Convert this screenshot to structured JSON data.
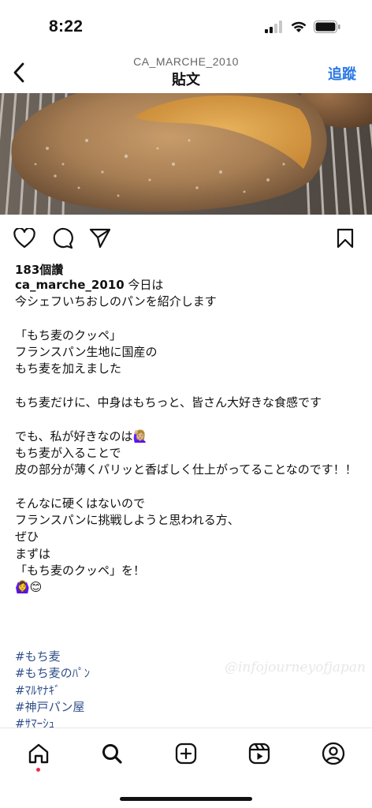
{
  "status": {
    "time": "8:22"
  },
  "nav": {
    "subtitle": "CA_MARCHE_2010",
    "title": "貼文",
    "follow": "追蹤"
  },
  "post": {
    "likes": "183個讚",
    "username": "ca_marche_2010",
    "caption": " 今日は\n今シェフいちおしのパンを紹介します\n\n「もち麦のクッペ」\nフランスパン生地に国産の\nもち麦を加えました\n\nもち麦だけに、中身はもちっと、皆さん大好きな食感です\n\nでも、私が好きなのは🙋🏼‍♀️\nもち麦が入ることで\n皮の部分が薄くパリッと香ばしく仕上がってることなのです！！\n\nそんなに硬くはないので\nフランスパンに挑戦しようと思われる方、\nぜひ\nまずは\n「もち麦のクッペ」を！\n🙆‍♀️😊",
    "hashtags": [
      "#もち麦",
      "#もち麦のﾊﾟﾝ",
      "#ﾏﾙﾔﾅｷﾞ",
      "#神戸パン屋",
      "#ｻﾏｰｼｭ"
    ],
    "watermark": "@infojourneyofjapan"
  },
  "icons": {
    "back": "chevron-left-icon",
    "like": "heart-icon",
    "comment": "comment-bubble-icon",
    "share": "paper-plane-icon",
    "save": "bookmark-icon",
    "tabs": [
      "home-icon",
      "search-icon",
      "add-post-icon",
      "reels-icon",
      "profile-icon"
    ]
  },
  "colors": {
    "link": "#2a78e4",
    "hashtag": "#2f4f8a",
    "notification_dot": "#ef2a4c"
  }
}
